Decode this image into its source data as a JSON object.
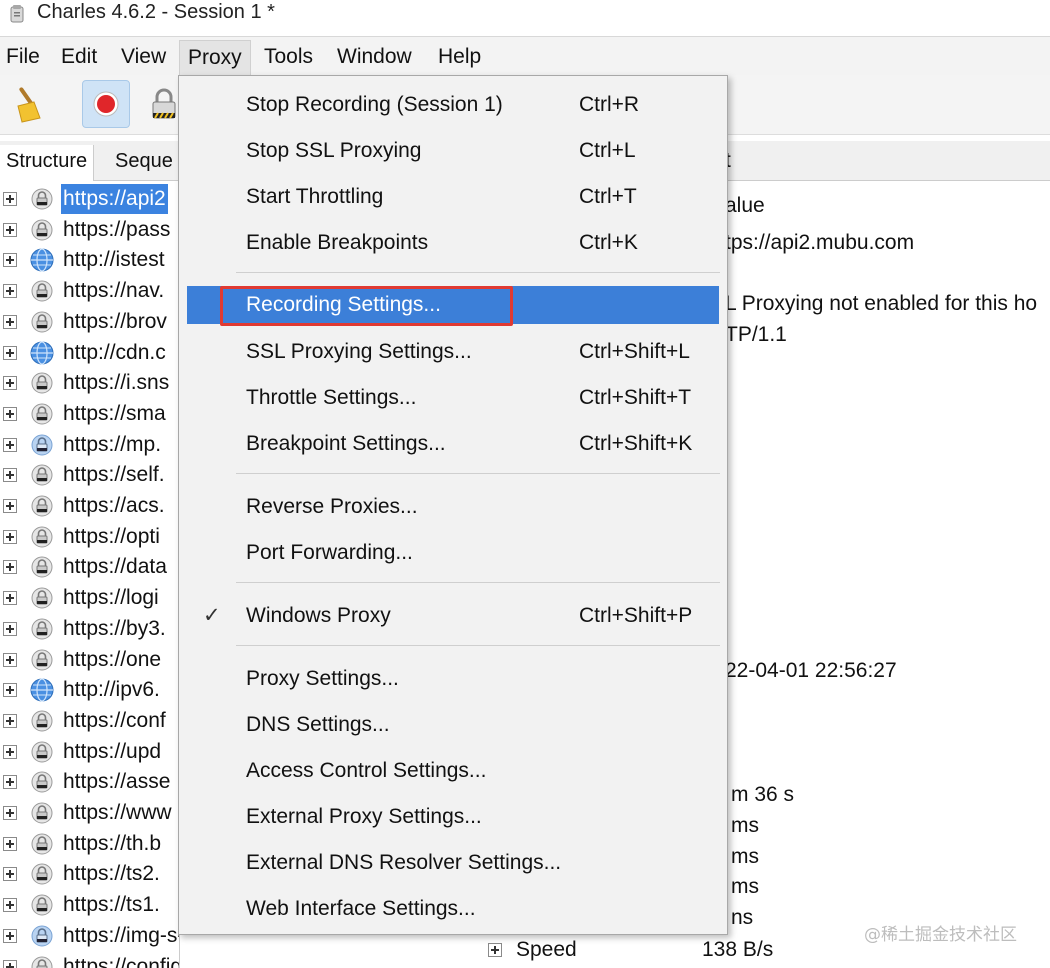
{
  "window": {
    "title": "Charles 4.6.2 - Session 1 *"
  },
  "menubar": {
    "items": [
      "File",
      "Edit",
      "View",
      "Proxy",
      "Tools",
      "Window",
      "Help"
    ]
  },
  "toolbar": {
    "tools": [
      "broom-icon",
      "record-icon",
      "ssl-lock-icon"
    ]
  },
  "left_panel": {
    "tabs": [
      "Structure",
      "Seque"
    ],
    "rows": [
      {
        "text": "https://api2",
        "icon": "lock-icon",
        "selected": true
      },
      {
        "text": "https://pass",
        "icon": "lock-icon"
      },
      {
        "text": "http://istest",
        "icon": "globe-icon"
      },
      {
        "text": "https://nav.",
        "icon": "lock-icon"
      },
      {
        "text": "https://brov",
        "icon": "lock-icon"
      },
      {
        "text": "http://cdn.c",
        "icon": "globe-icon"
      },
      {
        "text": "https://i.sns",
        "icon": "lock-icon"
      },
      {
        "text": "https://sma",
        "icon": "lock-icon"
      },
      {
        "text": "https://mp.",
        "icon": "lock-globe-icon"
      },
      {
        "text": "https://self.",
        "icon": "lock-icon"
      },
      {
        "text": "https://acs.",
        "icon": "lock-icon"
      },
      {
        "text": "https://opti",
        "icon": "lock-icon"
      },
      {
        "text": "https://data",
        "icon": "lock-icon"
      },
      {
        "text": "https://logi",
        "icon": "lock-icon"
      },
      {
        "text": "https://by3.",
        "icon": "lock-icon"
      },
      {
        "text": "https://one",
        "icon": "lock-icon"
      },
      {
        "text": "http://ipv6.",
        "icon": "globe-icon"
      },
      {
        "text": "https://conf",
        "icon": "lock-icon"
      },
      {
        "text": "https://upd",
        "icon": "lock-icon"
      },
      {
        "text": "https://asse",
        "icon": "lock-icon"
      },
      {
        "text": "https://www",
        "icon": "lock-icon"
      },
      {
        "text": "https://th.b",
        "icon": "lock-icon"
      },
      {
        "text": "https://ts2.",
        "icon": "lock-icon"
      },
      {
        "text": "https://ts1.",
        "icon": "lock-icon"
      },
      {
        "text": "https://img-s-msn-com.akamaized",
        "icon": "lock-globe-icon"
      },
      {
        "text": "https://config.edge.skype.com",
        "icon": "lock-icon"
      }
    ]
  },
  "right_panel": {
    "header": "t",
    "column_value": "alue",
    "lines": [
      "tps://api2.mubu.com",
      "L Proxying not enabled for this ho",
      "TP/1.1",
      "22-04-01 22:56:27",
      "m 36 s",
      "ms",
      "ms",
      "ms",
      "ns"
    ],
    "speed_label": "Speed",
    "speed_value": "138 B/s"
  },
  "proxy_menu": {
    "items": [
      {
        "label": "Stop Recording (Session 1)",
        "shortcut": "Ctrl+R"
      },
      {
        "label": "Stop SSL Proxying",
        "shortcut": "Ctrl+L"
      },
      {
        "label": "Start Throttling",
        "shortcut": "Ctrl+T"
      },
      {
        "label": "Enable Breakpoints",
        "shortcut": "Ctrl+K"
      },
      {
        "label": "Recording Settings...",
        "shortcut": "",
        "highlighted": true
      },
      {
        "label": "SSL Proxying Settings...",
        "shortcut": "Ctrl+Shift+L"
      },
      {
        "label": "Throttle Settings...",
        "shortcut": "Ctrl+Shift+T"
      },
      {
        "label": "Breakpoint Settings...",
        "shortcut": "Ctrl+Shift+K"
      },
      {
        "label": "Reverse Proxies...",
        "shortcut": ""
      },
      {
        "label": "Port Forwarding...",
        "shortcut": ""
      },
      {
        "label": "Windows Proxy",
        "shortcut": "Ctrl+Shift+P",
        "checked": true
      },
      {
        "label": "Proxy Settings...",
        "shortcut": ""
      },
      {
        "label": "DNS Settings...",
        "shortcut": ""
      },
      {
        "label": "Access Control Settings...",
        "shortcut": ""
      },
      {
        "label": "External Proxy Settings...",
        "shortcut": ""
      },
      {
        "label": "External DNS Resolver Settings...",
        "shortcut": ""
      },
      {
        "label": "Web Interface Settings...",
        "shortcut": ""
      }
    ],
    "check_mark": "✓"
  },
  "watermark": "@稀土掘金技术社区",
  "colors": {
    "selection_blue": "#3b83e0",
    "menu_highlight": "#3c7fd8",
    "annotation_red": "#e03a32"
  }
}
